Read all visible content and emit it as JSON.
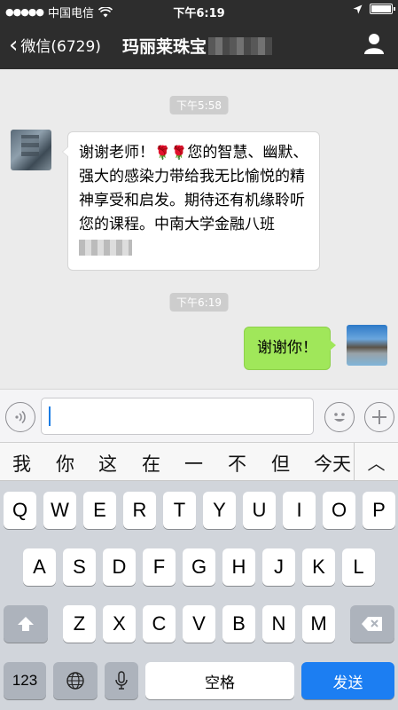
{
  "status_bar": {
    "carrier": "中国电信",
    "time": "下午6:19"
  },
  "nav": {
    "back_label": "微信(6729)",
    "title": "玛丽莱珠宝"
  },
  "chat": {
    "timestamps": [
      "下午5:58",
      "下午6:19"
    ],
    "messages": [
      {
        "side": "left",
        "text_a": "谢谢老师！",
        "text_b": "您的智慧、幽默、强大的感染力带给我无比愉悦的精神享受和启发。期待还有机缘聆听您的课程。中南大学金融八班"
      },
      {
        "side": "right",
        "text": "谢谢你！"
      }
    ]
  },
  "candidates": [
    "我",
    "你",
    "这",
    "在",
    "一",
    "不",
    "但",
    "今天"
  ],
  "keyboard": {
    "row1": [
      "Q",
      "W",
      "E",
      "R",
      "T",
      "Y",
      "U",
      "I",
      "O",
      "P"
    ],
    "row2": [
      "A",
      "S",
      "D",
      "F",
      "G",
      "H",
      "J",
      "K",
      "L"
    ],
    "row3": [
      "Z",
      "X",
      "C",
      "V",
      "B",
      "N",
      "M"
    ],
    "num_label": "123",
    "space_label": "空格",
    "send_label": "发送"
  },
  "colors": {
    "header": "#2d2d2d",
    "sent_bubble": "#a0e75a",
    "send_key": "#1c7ef2"
  }
}
